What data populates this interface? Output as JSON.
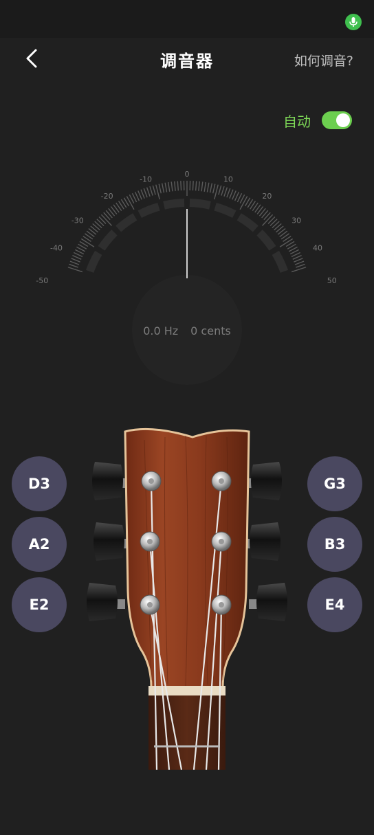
{
  "nav": {
    "title": "调音器",
    "help_link": "如何调音?"
  },
  "auto_mode": {
    "label": "自动",
    "enabled": true
  },
  "gauge": {
    "ticks": [
      "-50",
      "-40",
      "-30",
      "-20",
      "-10",
      "0",
      "10",
      "20",
      "30",
      "40",
      "50"
    ],
    "frequency": "0.0 Hz",
    "cents": "0 cents"
  },
  "strings": {
    "left": [
      {
        "note": "D3"
      },
      {
        "note": "A2"
      },
      {
        "note": "E2"
      }
    ],
    "right": [
      {
        "note": "G3"
      },
      {
        "note": "B3"
      },
      {
        "note": "E4"
      }
    ]
  },
  "colors": {
    "accent_green": "#7ed957",
    "string_button": "#4a4860",
    "wood": "#8b3a1e"
  }
}
